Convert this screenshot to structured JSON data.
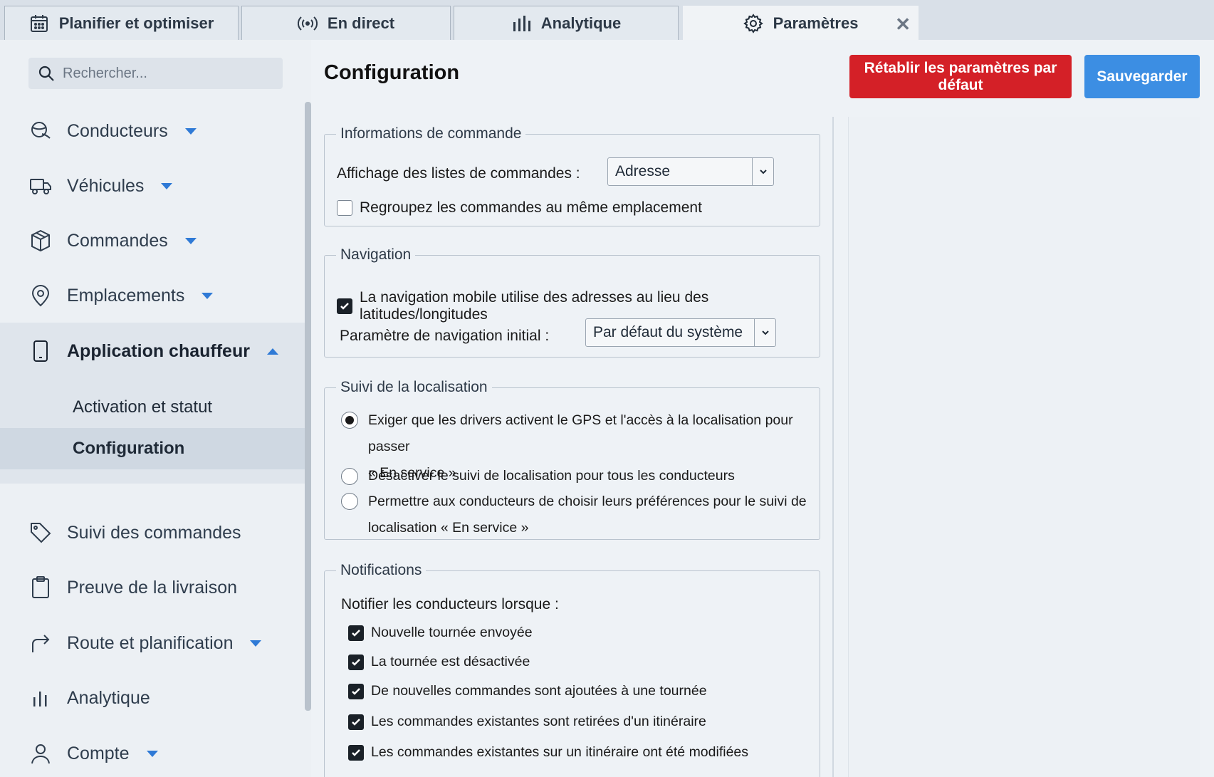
{
  "tabs": [
    {
      "label": "Planifier et optimiser",
      "icon": "calendar-icon"
    },
    {
      "label": "En direct",
      "icon": "broadcast-icon"
    },
    {
      "label": "Analytique",
      "icon": "bar-chart-icon"
    },
    {
      "label": "Paramètres",
      "icon": "gear-icon",
      "active": true
    }
  ],
  "tab_close_label": "✕",
  "search": {
    "placeholder": "Rechercher..."
  },
  "sidebar": {
    "items": [
      {
        "label": "Conducteurs",
        "icon": "steering-wheel-icon",
        "expandable": true
      },
      {
        "label": "Véhicules",
        "icon": "truck-icon",
        "expandable": true
      },
      {
        "label": "Commandes",
        "icon": "package-icon",
        "expandable": true
      },
      {
        "label": "Emplacements",
        "icon": "map-pin-icon",
        "expandable": true
      },
      {
        "label": "Application chauffeur",
        "icon": "phone-icon",
        "expanded": true
      },
      {
        "label": "Suivi des commandes",
        "icon": "tag-icon"
      },
      {
        "label": "Preuve de la livraison",
        "icon": "clipboard-icon"
      },
      {
        "label": "Route et planification",
        "icon": "share-arrow-icon",
        "expandable": true
      },
      {
        "label": "Analytique",
        "icon": "bar-chart-icon"
      },
      {
        "label": "Compte",
        "icon": "user-icon",
        "expandable": true
      }
    ],
    "subitems": [
      {
        "label": "Activation et statut"
      },
      {
        "label": "Configuration",
        "selected": true
      }
    ]
  },
  "main": {
    "title": "Configuration",
    "reset_label": "Rétablir les paramètres par défaut",
    "save_label": "Sauvegarder"
  },
  "colors": {
    "reset": "#d42027",
    "save": "#3c8ee3",
    "caret": "#2f7ad6"
  },
  "order_info": {
    "legend": "Informations de commande",
    "display_label": "Affichage des listes de commandes :",
    "display_value": "Adresse",
    "group_label": "Regroupez les commandes au même emplacement",
    "group_checked": false
  },
  "navigation": {
    "legend": "Navigation",
    "mobile_label": "La navigation mobile utilise des adresses au lieu des latitudes/longitudes",
    "mobile_checked": true,
    "initial_label": "Paramètre de navigation initial :",
    "initial_value": "Par défaut du système"
  },
  "location": {
    "legend": "Suivi de la localisation",
    "options": [
      {
        "line1": "Exiger que les drivers activent le GPS et l'accès à la localisation pour passer",
        "line2": "« En service »",
        "selected": true
      },
      {
        "line1": "Désactiver le suivi de localisation pour tous les conducteurs",
        "line2": "",
        "selected": false
      },
      {
        "line1": "Permettre aux conducteurs de choisir leurs préférences pour le suivi de",
        "line2": "localisation « En service »",
        "selected": false
      }
    ]
  },
  "notifications": {
    "legend": "Notifications",
    "intro": "Notifier les conducteurs lorsque :",
    "items": [
      {
        "label": "Nouvelle tournée envoyée",
        "checked": true
      },
      {
        "label": "La tournée est désactivée",
        "checked": true
      },
      {
        "label": "De nouvelles commandes sont ajoutées à une tournée",
        "checked": true
      },
      {
        "label": "Les commandes existantes sont retirées d'un itinéraire",
        "checked": true
      },
      {
        "label": "Les commandes existantes sur un itinéraire ont été modifiées",
        "checked": true
      }
    ]
  }
}
